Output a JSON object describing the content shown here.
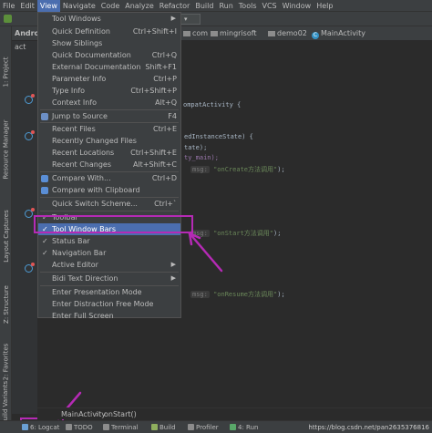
{
  "menubar": {
    "items": [
      "File",
      "Edit",
      "View",
      "Navigate",
      "Code",
      "Analyze",
      "Refactor",
      "Build",
      "Run",
      "Tools",
      "VCS",
      "Window",
      "Help"
    ],
    "active": "View"
  },
  "navbar": {
    "project_label": "Androi",
    "open_file": "act",
    "crumbs": [
      "com",
      "mingrisoft",
      "demo02",
      "MainActivity"
    ]
  },
  "left_tool_windows": [
    "1: Project",
    "Resource Manager",
    "Layout Captures",
    "Z: Structure",
    "2: Favorites",
    "Build Variants"
  ],
  "code_lines": [
    {
      "text": "ompatActivity {"
    },
    {
      "text": "edInstanceState) {"
    },
    {
      "text": "tate);"
    },
    {
      "text": "ty_main);"
    },
    {
      "hint": "msg:",
      "str": "\"onCreate方法调用\"",
      "tail": ");"
    },
    {
      "hint": "msg:",
      "str": "\"onStart方法调用\"",
      "tail": ");"
    },
    {
      "hint": "msg:",
      "str": "\"onResume方法调用\"",
      "tail": ");"
    }
  ],
  "view_menu": {
    "items": [
      {
        "label": "Tool Windows",
        "submenu": true
      },
      {
        "label": "Quick Definition",
        "shortcut": "Ctrl+Shift+I"
      },
      {
        "label": "Show Siblings"
      },
      {
        "label": "Quick Documentation",
        "shortcut": "Ctrl+Q"
      },
      {
        "label": "External Documentation",
        "shortcut": "Shift+F1"
      },
      {
        "label": "Parameter Info",
        "shortcut": "Ctrl+P"
      },
      {
        "label": "Type Info",
        "shortcut": "Ctrl+Shift+P"
      },
      {
        "label": "Context Info",
        "shortcut": "Alt+Q"
      },
      {
        "label": "Jump to Source",
        "shortcut": "F4"
      },
      {
        "label": "Recent Files",
        "shortcut": "Ctrl+E"
      },
      {
        "label": "Recently Changed Files"
      },
      {
        "label": "Recent Locations",
        "shortcut": "Ctrl+Shift+E"
      },
      {
        "label": "Recent Changes",
        "shortcut": "Alt+Shift+C"
      },
      {
        "label": "Compare With...",
        "shortcut": "Ctrl+D"
      },
      {
        "label": "Compare with Clipboard"
      },
      {
        "label": "Quick Switch Scheme...",
        "shortcut": "Ctrl+`"
      },
      {
        "label": "Toolbar",
        "checked": true
      },
      {
        "label": "Tool Window Bars",
        "checked": true,
        "highlighted": true
      },
      {
        "label": "Status Bar",
        "checked": true
      },
      {
        "label": "Navigation Bar",
        "checked": true
      },
      {
        "label": "Active Editor",
        "submenu": true
      },
      {
        "label": "Bidi Text Direction",
        "submenu": true
      },
      {
        "label": "Enter Presentation Mode"
      },
      {
        "label": "Enter Distraction Free Mode"
      },
      {
        "label": "Enter Full Screen"
      }
    ]
  },
  "editor_breadcrumb": [
    "MainActivity",
    "onStart()"
  ],
  "bottom_tabs": [
    "6: Logcat",
    "TODO",
    "Terminal",
    "Build",
    "Profiler",
    "4: Run"
  ],
  "watermark": "https://blog.csdn.net/pan2635376816",
  "colors": {
    "menu_bg": "#3c3f41",
    "highlight": "#4b6eaf",
    "annotation": "#b52ab5",
    "editor_bg": "#2b2b2b"
  }
}
